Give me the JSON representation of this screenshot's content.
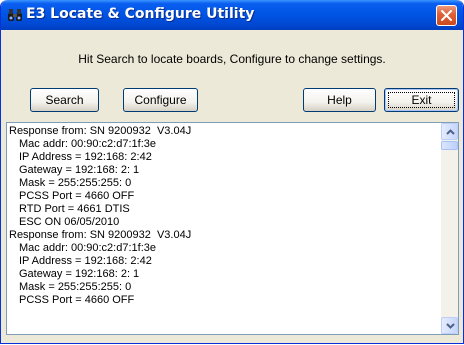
{
  "window": {
    "title": "E3 Locate & Configure Utility",
    "icon": "binoculars-icon"
  },
  "instruction": "Hit Search to locate boards, Configure to change settings.",
  "buttons": {
    "search": "Search",
    "configure": "Configure",
    "help": "Help",
    "exit": "Exit"
  },
  "output": {
    "lines": [
      {
        "text": "Response from: SN 9200932  V3.04J",
        "indent": false
      },
      {
        "text": "Mac addr: 00:90:c2:d7:1f:3e",
        "indent": true
      },
      {
        "text": "IP Address = 192:168: 2:42",
        "indent": true
      },
      {
        "text": "Gateway = 192:168: 2: 1",
        "indent": true
      },
      {
        "text": "Mask = 255:255:255: 0",
        "indent": true
      },
      {
        "text": "PCSS Port = 4660 OFF",
        "indent": true
      },
      {
        "text": "RTD Port = 4661 DTIS",
        "indent": true
      },
      {
        "text": "ESC ON 06/05/2010",
        "indent": true
      },
      {
        "text": "Response from: SN 9200932  V3.04J",
        "indent": false
      },
      {
        "text": "Mac addr: 00:90:c2:d7:1f:3e",
        "indent": true
      },
      {
        "text": "IP Address = 192:168: 2:42",
        "indent": true
      },
      {
        "text": "Gateway = 192:168: 2: 1",
        "indent": true
      },
      {
        "text": "Mask = 255:255:255: 0",
        "indent": true
      },
      {
        "text": "PCSS Port = 4660 OFF",
        "indent": true
      }
    ]
  },
  "colors": {
    "titlebar": "#0055e5",
    "close": "#e1613a",
    "face": "#ece9d8"
  }
}
